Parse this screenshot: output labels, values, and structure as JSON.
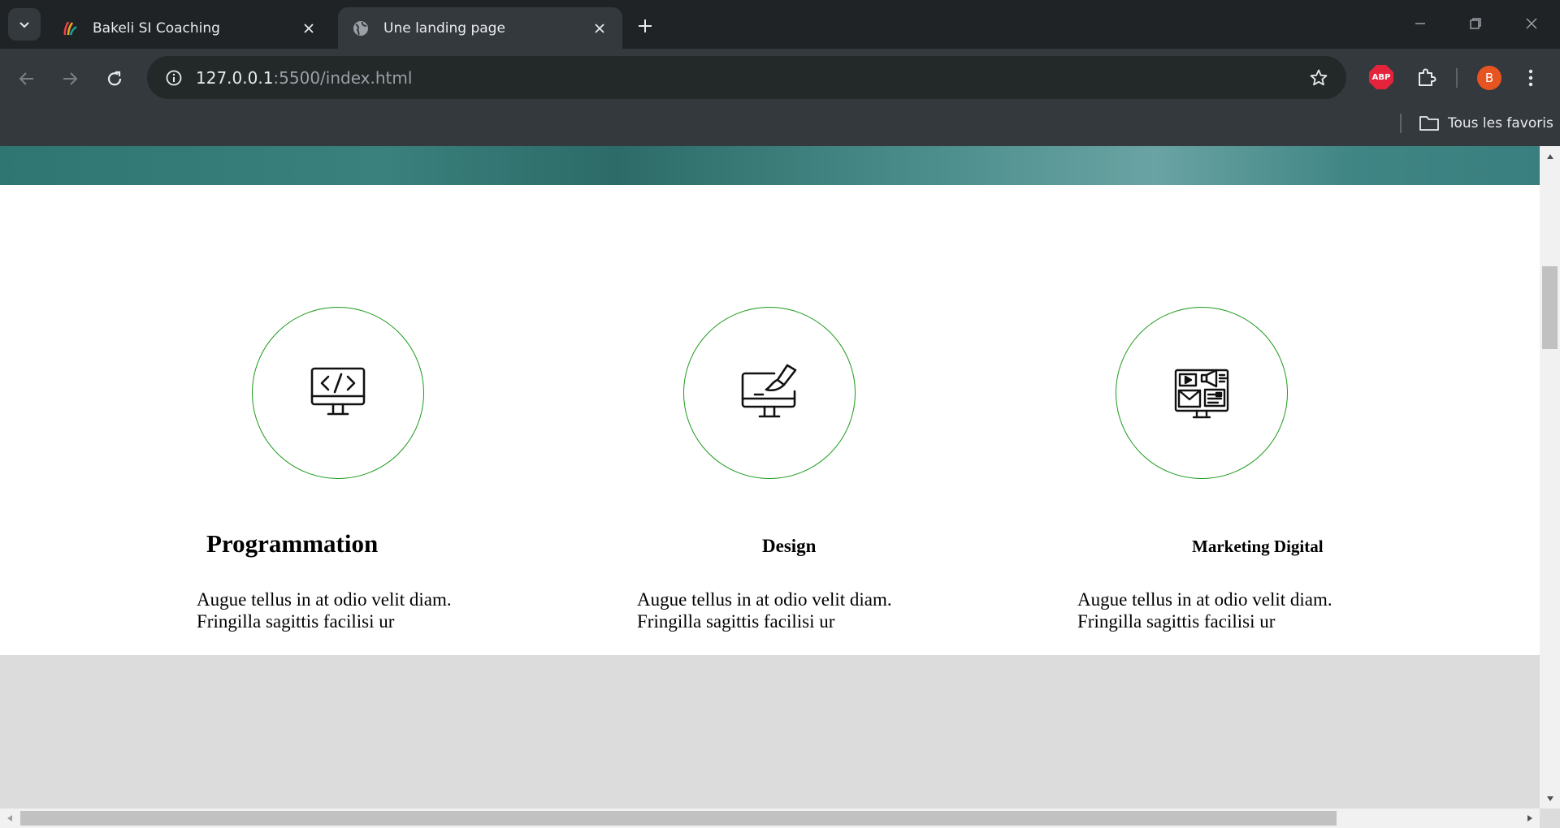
{
  "browser": {
    "tabs": [
      {
        "title": "Bakeli SI Coaching",
        "favicon": "bakeli-logo-icon",
        "active": false
      },
      {
        "title": "Une landing page",
        "favicon": "globe-icon",
        "active": true
      }
    ],
    "url_host": "127.0.0.1",
    "url_rest": ":5500/index.html",
    "abp_label": "ABP",
    "profile_initial": "B",
    "bookmarks_label": "Tous les favoris",
    "colors": {
      "tabbar": "#1f2326",
      "toolbar": "#33393d",
      "profile": "#e8541f",
      "abp": "#e4243c"
    }
  },
  "page": {
    "services": [
      {
        "icon": "code-monitor-icon",
        "title": "Programmation",
        "text": "Augue tellus in at odio velit diam. Fringilla sagittis facilisi ur"
      },
      {
        "icon": "design-monitor-icon",
        "title": "Design",
        "text": "Augue tellus in at odio velit diam. Fringilla sagittis facilisi ur"
      },
      {
        "icon": "marketing-monitor-icon",
        "title": "Marketing Digital",
        "text": "Augue tellus in at odio velit diam. Fringilla sagittis facilisi ur"
      }
    ],
    "colors": {
      "circle_border": "#1d9a1d",
      "gray_section": "#dcdcdc",
      "hero": "#2f7572"
    }
  }
}
